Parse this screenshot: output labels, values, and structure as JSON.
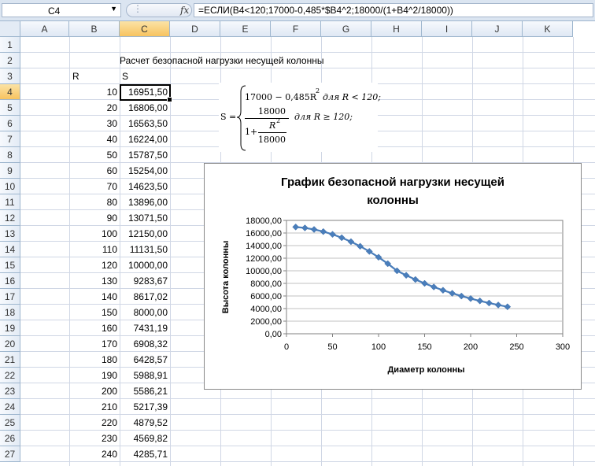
{
  "formula_bar": {
    "name_box": "C4",
    "fx_label": "fx",
    "formula": "=ЕСЛИ(B4<120;17000-0,485*$B4^2;18000/(1+B4^2/18000))"
  },
  "columns": [
    "A",
    "B",
    "C",
    "D",
    "E",
    "F",
    "G",
    "H",
    "I",
    "J",
    "K"
  ],
  "rows": [
    "1",
    "2",
    "3",
    "4",
    "5",
    "6",
    "7",
    "8",
    "9",
    "10",
    "11",
    "12",
    "13",
    "14",
    "15",
    "16",
    "17",
    "18",
    "19",
    "20",
    "21",
    "22",
    "23",
    "24",
    "25",
    "26",
    "27"
  ],
  "sheet": {
    "title": "Расчет безопасной нагрузки несущей колонны",
    "header_r": "R",
    "header_s": "S",
    "r_values": [
      "10",
      "20",
      "30",
      "40",
      "50",
      "60",
      "70",
      "80",
      "90",
      "100",
      "110",
      "120",
      "130",
      "140",
      "150",
      "160",
      "170",
      "180",
      "190",
      "200",
      "210",
      "220",
      "230",
      "240"
    ],
    "s_values": [
      "16951,50",
      "16806,00",
      "16563,50",
      "16224,00",
      "15787,50",
      "15254,00",
      "14623,50",
      "13896,00",
      "13071,50",
      "12150,00",
      "11131,50",
      "10000,00",
      "9283,67",
      "8617,02",
      "8000,00",
      "7431,19",
      "6908,32",
      "6428,57",
      "5988,91",
      "5586,21",
      "5217,39",
      "4879,52",
      "4569,82",
      "4285,71"
    ]
  },
  "equation": {
    "lhs": "S =",
    "case1": "17000 − 0,485R",
    "exp": "2",
    "cond1": "для R < 120;",
    "num": "18000",
    "den_one": "1+",
    "den_r": "R",
    "den_base": "18000",
    "cond2": "для R ≥ 120;"
  },
  "chart_data": {
    "type": "line",
    "title": "График безопасной нагрузки несущей колонны",
    "xlabel": "Диаметр колонны",
    "ylabel": "Высота колонны",
    "xlim": [
      0,
      300
    ],
    "ylim": [
      0,
      18000
    ],
    "x_ticks": [
      "0",
      "50",
      "100",
      "150",
      "200",
      "250",
      "300"
    ],
    "y_ticks": [
      "0,00",
      "2000,00",
      "4000,00",
      "6000,00",
      "8000,00",
      "10000,00",
      "12000,00",
      "14000,00",
      "16000,00",
      "18000,00"
    ],
    "grid": true,
    "legend": "none",
    "color": "#4a7ebb",
    "series": [
      {
        "x": [
          10,
          20,
          30,
          40,
          50,
          60,
          70,
          80,
          90,
          100,
          110,
          120,
          130,
          140,
          150,
          160,
          170,
          180,
          190,
          200,
          210,
          220,
          230,
          240
        ],
        "y": [
          16951.5,
          16806,
          16563.5,
          16224,
          15787.5,
          15254,
          14623.5,
          13896,
          13071.5,
          12150,
          11131.5,
          10000,
          9283.67,
          8617.02,
          8000,
          7431.19,
          6908.32,
          6428.57,
          5988.91,
          5586.21,
          5217.39,
          4879.52,
          4569.82,
          4285.71
        ]
      }
    ]
  }
}
